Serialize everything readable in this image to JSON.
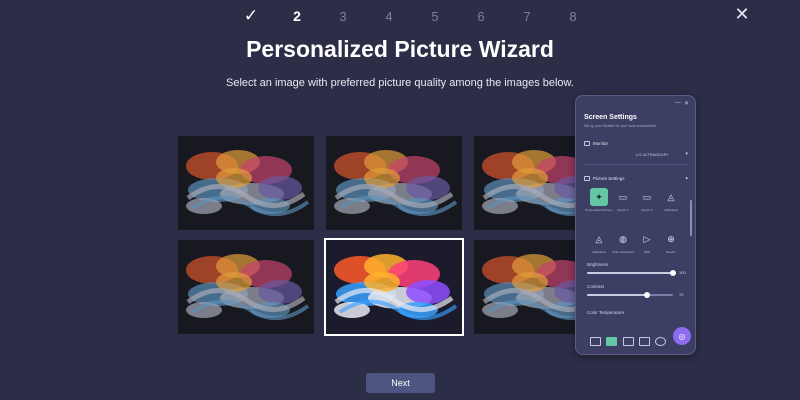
{
  "wizard": {
    "steps": [
      "✓",
      "2",
      "3",
      "4",
      "5",
      "6",
      "7",
      "8"
    ],
    "title": "Personalized Picture Wizard",
    "subtitle": "Select an image with preferred picture quality among the images below.",
    "next_label": "Next",
    "selected_image_index": 4,
    "image_count": 6
  },
  "panel": {
    "title": "Screen Settings",
    "subtitle": "Set up your Monitor for your work environment.",
    "monitor_section": "Monitor",
    "monitor_name": "LG ULTRAGEAR+",
    "picture_section": "Picture Settings",
    "modes": [
      {
        "label": "Personalized Picture",
        "icon": "✦"
      },
      {
        "label": "Gamer 1",
        "icon": "▭"
      },
      {
        "label": "Gamer 2",
        "icon": "▭"
      },
      {
        "label": "Calibration",
        "icon": "◬"
      },
      {
        "label": "Calibration",
        "icon": "◬"
      },
      {
        "label": "Color Weakness",
        "icon": "◍"
      },
      {
        "label": "HDR",
        "icon": "▷"
      },
      {
        "label": "Reader",
        "icon": "⊕"
      }
    ],
    "brightness_label": "Brightness",
    "brightness_value": "100",
    "brightness_fraction": 1.0,
    "contrast_label": "Contrast",
    "contrast_value": "70",
    "contrast_fraction": 0.7,
    "color_temp_label": "Color Temperature",
    "bottom_icons": [
      "monitor-icon",
      "picture-icon",
      "screen-icon",
      "video-icon",
      "settings-icon"
    ],
    "accent_color": "#63c7a6",
    "fab_color": "#8d6cf2"
  }
}
